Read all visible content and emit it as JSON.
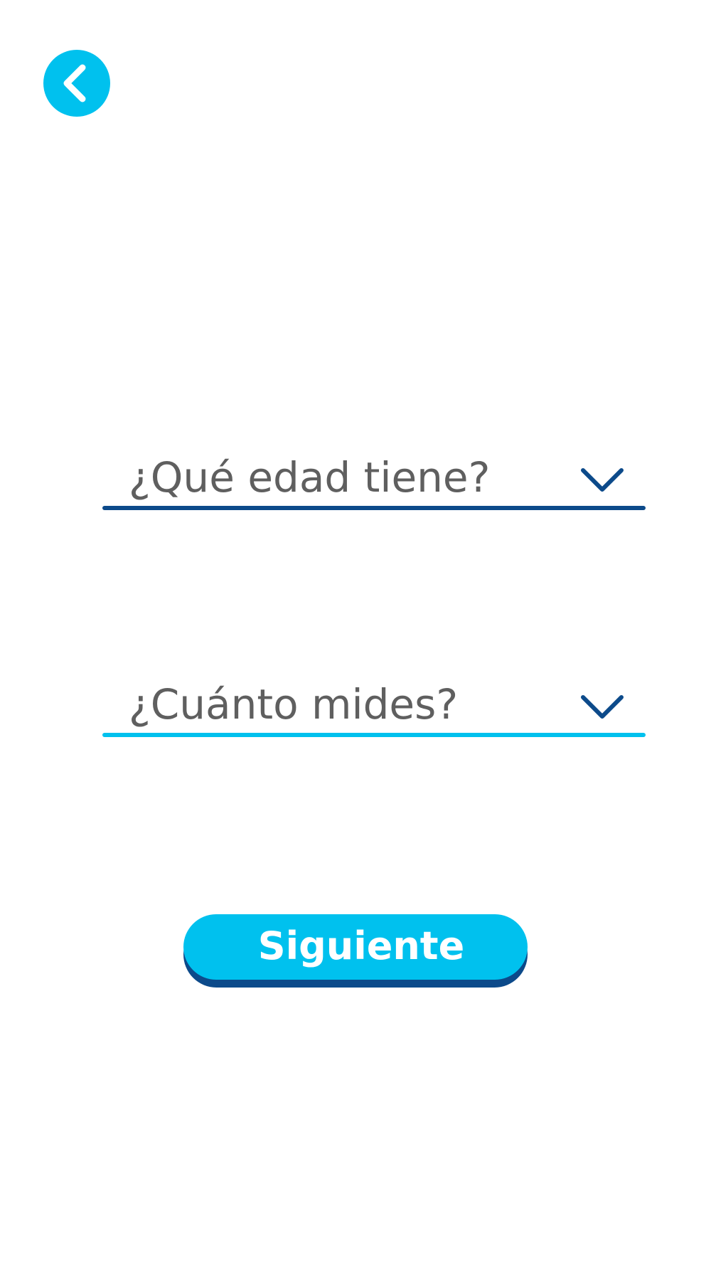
{
  "header": {
    "back_icon": "chevron-left-icon"
  },
  "form": {
    "age": {
      "placeholder": "¿Qué edad tiene?",
      "icon": "chevron-down-icon",
      "underline_color": "#0c4a8a"
    },
    "height": {
      "placeholder": "¿Cuánto mides?",
      "icon": "chevron-down-icon",
      "underline_color": "#00c1ee"
    }
  },
  "actions": {
    "next_label": "Siguiente"
  },
  "colors": {
    "accent": "#00c1ee",
    "dark_blue": "#0c4a8a",
    "placeholder_text": "#5f5f5f",
    "background": "#ffffff"
  }
}
